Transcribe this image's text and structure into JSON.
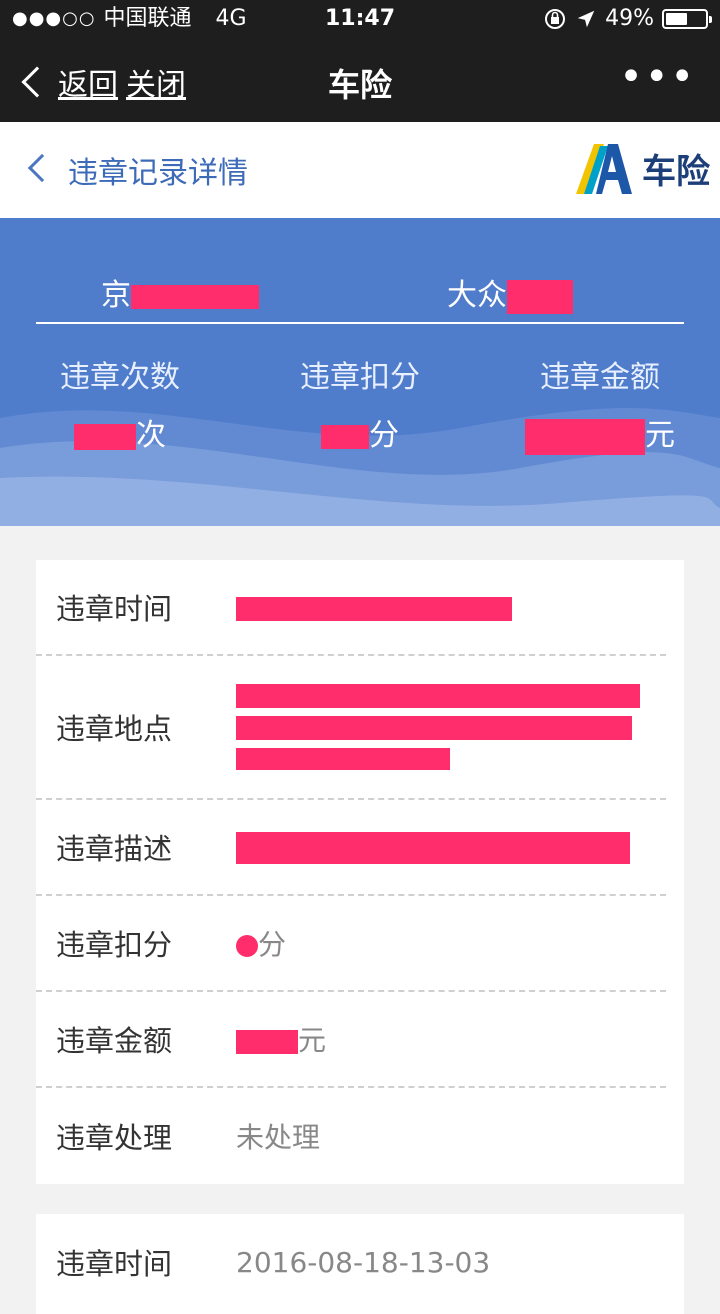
{
  "status_bar": {
    "signal": "●●●○○",
    "carrier": "中国联通",
    "network": "4G",
    "time": "11:47",
    "lock_icon": "rotation-lock-icon",
    "location_icon": "location-arrow-icon",
    "battery_percent": "49%",
    "battery_level": 0.49
  },
  "wechat_nav": {
    "back_label": "返回",
    "close_label": "关闭",
    "title": "车险",
    "more_label": "•••"
  },
  "sub_header": {
    "title": "违章记录详情",
    "brand_name": "车险",
    "brand_logo_letter": "A"
  },
  "summary": {
    "plate_prefix": "京",
    "model_prefix": "大众",
    "stats": [
      {
        "label": "违章次数",
        "unit": "次"
      },
      {
        "label": "违章扣分",
        "unit": "分"
      },
      {
        "label": "违章金额",
        "unit": "元"
      }
    ]
  },
  "records": [
    {
      "rows": [
        {
          "label": "违章时间",
          "value": ""
        },
        {
          "label": "违章地点",
          "value": ""
        },
        {
          "label": "违章描述",
          "value": ""
        },
        {
          "label": "违章扣分",
          "value": "分"
        },
        {
          "label": "违章金额",
          "value": "元"
        },
        {
          "label": "违章处理",
          "value": "未处理"
        }
      ]
    },
    {
      "rows": [
        {
          "label": "违章时间",
          "value": "2016-08-18-13-03"
        }
      ]
    }
  ],
  "colors": {
    "banner_blue": "#4f7ccb",
    "nav_dark": "#1e1e1e",
    "link_blue": "#3d6bb8",
    "redaction": "#ff2d6c"
  }
}
